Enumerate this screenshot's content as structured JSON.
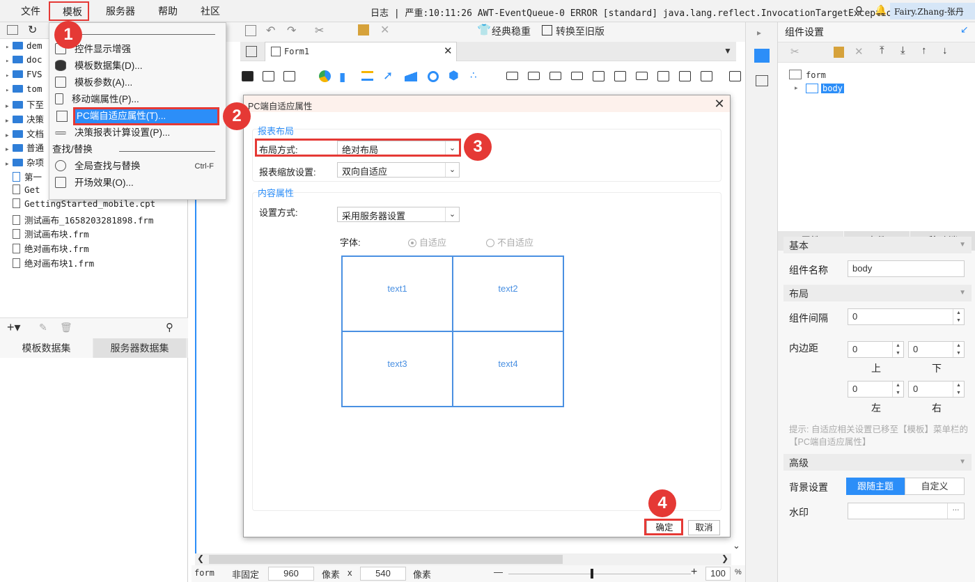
{
  "menubar": {
    "items": [
      "文件",
      "模板",
      "服务器",
      "帮助",
      "社区"
    ],
    "log": "日志 | 严重:10:11:26 AWT-EventQueue-0 ERROR [standard] java.lang.reflect.InvocationTargetException",
    "user": "Fairy.Zhang-张丹"
  },
  "tree": {
    "folders": [
      "dem",
      "doc",
      "FVS",
      "tom",
      "下至",
      "决策",
      "文档",
      "普通",
      "杂项"
    ],
    "items": [
      "第一",
      "Get",
      "GettingStarted_mobile.cpt",
      "测试画布_1658203281898.frm",
      "测试画布块.frm",
      "绝对画布块.frm",
      "绝对画布块1.frm"
    ]
  },
  "dataset_tabs": [
    "模板数据集",
    "服务器数据集"
  ],
  "template_menu": {
    "items": [
      {
        "label": "控件显示增强",
        "shortcut": ""
      },
      {
        "label": "模板数据集(D)...",
        "shortcut": ""
      },
      {
        "label": "模板参数(A)...",
        "shortcut": ""
      },
      {
        "label": "移动端属性(P)...",
        "shortcut": ""
      },
      {
        "label": "PC端自适应属性(T)...",
        "shortcut": ""
      },
      {
        "label": "决策报表计算设置(P)...",
        "shortcut": ""
      },
      {
        "label": "全局查找与替换",
        "shortcut": "Ctrl-F"
      },
      {
        "label": "开场效果(O)...",
        "shortcut": ""
      }
    ],
    "section_find": "查找/替换"
  },
  "toolbar": {
    "classic_theme": "经典稳重",
    "convert_old": "转换至旧版"
  },
  "tab": {
    "label": "Form1"
  },
  "dialog": {
    "title": "PC端自适应属性",
    "section_layout": "报表布局",
    "layout_label": "布局方式:",
    "layout_value": "绝对布局",
    "scale_label": "报表缩放设置:",
    "scale_value": "双向自适应",
    "section_content": "内容属性",
    "setting_label": "设置方式:",
    "setting_value": "采用服务器设置",
    "font_label": "字体:",
    "font_adaptive": "自适应",
    "font_not_adaptive": "不自适应",
    "cells": [
      "text1",
      "text2",
      "text3",
      "text4"
    ],
    "ok": "确定",
    "cancel": "取消"
  },
  "markers": [
    "1",
    "2",
    "3",
    "4"
  ],
  "statusbar": {
    "form": "form",
    "nonfixed": "非固定",
    "width": "960",
    "px1": "像素",
    "times": "x",
    "height": "540",
    "px2": "像素",
    "minus": "—",
    "plus": "+",
    "zoom": "100",
    "percent": "%"
  },
  "right_panel": {
    "title": "组件设置",
    "tree": [
      "form",
      "body"
    ],
    "tabs": [
      "属性",
      "事件",
      "移动端"
    ],
    "basic": "基本",
    "name_label": "组件名称",
    "name_value": "body",
    "layout": "布局",
    "gap_label": "组件间隔",
    "gap_value": "0",
    "padding_label": "内边距",
    "padding": {
      "top": "0",
      "bottom": "0",
      "left": "0",
      "right": "0"
    },
    "pad_labels": {
      "top": "上",
      "bottom": "下",
      "left": "左",
      "right": "右"
    },
    "hint": "提示: 自适应相关设置已移至【模板】菜单栏的【PC端自适应属性】",
    "advanced": "高级",
    "bg_label": "背景设置",
    "bg_follow": "跟随主题",
    "bg_custom": "自定义",
    "watermark_label": "水印",
    "ellipsis": "···"
  },
  "colors": {
    "accent": "#2c8ef8",
    "marker": "#e53935",
    "preview_border": "#4a90e2"
  }
}
